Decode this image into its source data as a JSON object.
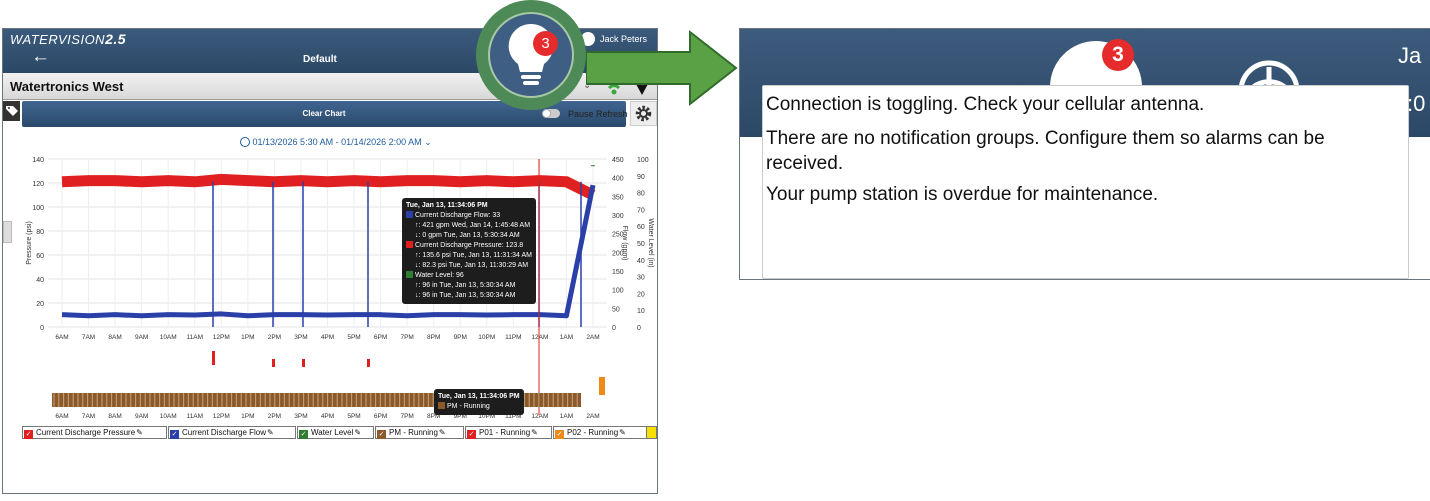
{
  "app": {
    "logo_text": "WATERVISION",
    "logo_version": "2.5",
    "window_title": "Default",
    "user": "Jack Peters",
    "station": "Watertronics West"
  },
  "toolbar": {
    "clear_chart": "Clear Chart",
    "pause_refresh": "Pause Refresh",
    "date_range": "01/13/2026 5:30 AM - 01/14/2026 2:00 AM"
  },
  "notifications": {
    "count": "3",
    "messages": [
      "Connection is toggling. Check your cellular antenna.",
      "There are no notification groups. Configure them so alarms can be received.",
      "Your pump station is overdue for maintenance."
    ]
  },
  "zoom_header": {
    "user_fragment": "Ja",
    "time_fragment": ":0"
  },
  "colors": {
    "pressure": "#e02020",
    "flow": "#2a3fa8",
    "water_level": "#2e7d32",
    "pm_running": "#8b5a2b",
    "p01_running": "#e02020",
    "p02_running": "#ee8a1a",
    "header": "#2f4c6e",
    "arrow": "#5aa045"
  },
  "chart_data": {
    "type": "line",
    "x": [
      "6AM",
      "7AM",
      "8AM",
      "9AM",
      "10AM",
      "11AM",
      "12PM",
      "1PM",
      "2PM",
      "3PM",
      "4PM",
      "5PM",
      "6PM",
      "7PM",
      "8PM",
      "9PM",
      "10PM",
      "11PM",
      "12AM",
      "1AM",
      "2AM"
    ],
    "y_left_label": "Pressure (psi)",
    "y_left_ticks": [
      "0",
      "20",
      "40",
      "60",
      "80",
      "100",
      "120",
      "140"
    ],
    "y_flow_label": "Flow (gpm)",
    "y_flow_ticks": [
      "0",
      "50",
      "100",
      "150",
      "200",
      "250",
      "300",
      "350",
      "400",
      "450"
    ],
    "y_level_label": "Water Level (in)",
    "y_level_ticks": [
      "0",
      "10",
      "20",
      "30",
      "40",
      "50",
      "60",
      "70",
      "80",
      "90",
      "100"
    ],
    "series": [
      {
        "name": "Current Discharge Pressure",
        "values": [
          121,
          122,
          122,
          121,
          122,
          121,
          123,
          122,
          121,
          122,
          121,
          122,
          121,
          122,
          122,
          121,
          122,
          121,
          122,
          121,
          110
        ]
      },
      {
        "name": "Current Discharge Flow",
        "values": [
          33,
          30,
          33,
          30,
          33,
          32,
          35,
          30,
          33,
          33,
          32,
          33,
          33,
          30,
          33,
          33,
          32,
          33,
          33,
          30,
          380
        ]
      },
      {
        "name": "Water Level",
        "values": [
          96,
          96,
          96,
          96,
          96,
          96,
          96,
          96,
          96,
          96,
          96,
          96,
          96,
          96,
          96,
          96,
          96,
          96,
          96,
          96,
          96
        ]
      }
    ],
    "tooltip_main": {
      "time": "Tue, Jan 13, 11:34:06 PM",
      "flow": "Current Discharge Flow: 33",
      "flow_max": "↑: 421 gpm Wed, Jan 14, 1:45:48 AM",
      "flow_min": "↓: 0 gpm Tue, Jan 13, 5:30:34 AM",
      "pressure": "Current Discharge Pressure: 123.8",
      "pressure_max": "↑: 135.6 psi Tue, Jan 13, 11:31:34 AM",
      "pressure_min": "↓: 82.3 psi Tue, Jan 13, 11:30:29 AM",
      "level": "Water Level: 96",
      "level_max": "↑: 96 in Tue, Jan 13, 5:30:34 AM",
      "level_min": "↓: 96 in Tue, Jan 13, 5:30:34 AM"
    },
    "tooltip_run": {
      "time": "Tue, Jan 13, 11:34:06 PM",
      "status": "PM - Running"
    }
  },
  "legend": [
    {
      "label": "Current Discharge Pressure",
      "color": "#e02020"
    },
    {
      "label": "Current Discharge Flow",
      "color": "#2a3fa8"
    },
    {
      "label": "Water Level",
      "color": "#2e7d32"
    },
    {
      "label": "PM - Running",
      "color": "#8b5a2b"
    },
    {
      "label": "P01 - Running",
      "color": "#e02020"
    },
    {
      "label": "P02 - Running",
      "color": "#ee8a1a"
    }
  ]
}
